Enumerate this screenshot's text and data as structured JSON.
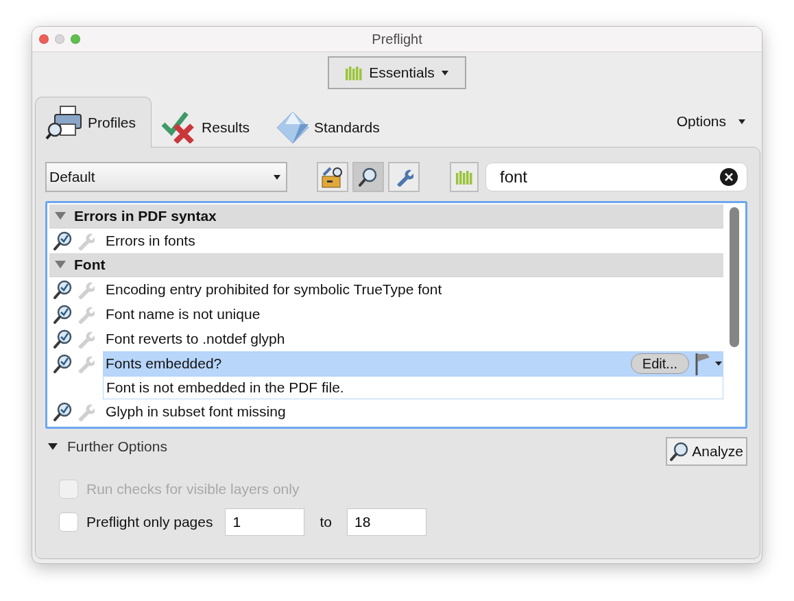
{
  "window": {
    "title": "Preflight"
  },
  "workspace_button": {
    "label": "Essentials"
  },
  "tabs": [
    {
      "label": "Profiles",
      "kind": "profiles",
      "selected": true
    },
    {
      "label": "Results",
      "kind": "results",
      "selected": false
    },
    {
      "label": "Standards",
      "kind": "standards",
      "selected": false
    }
  ],
  "options_menu": {
    "label": "Options"
  },
  "profile_select": {
    "value": "Default"
  },
  "view_buttons": [
    {
      "kind": "fixups",
      "selected": false
    },
    {
      "kind": "checks",
      "selected": true
    },
    {
      "kind": "wrench",
      "selected": false
    }
  ],
  "search": {
    "value": "font"
  },
  "groups": [
    {
      "label": "Errors in PDF syntax",
      "expanded": true,
      "items": [
        {
          "label": "Errors in fonts",
          "selected": false
        }
      ]
    },
    {
      "label": "Font",
      "expanded": true,
      "items": [
        {
          "label": "Encoding entry prohibited for symbolic TrueType font",
          "selected": false
        },
        {
          "label": "Font name is not unique",
          "selected": false
        },
        {
          "label": "Font reverts to .notdef glyph",
          "selected": false
        },
        {
          "label": "Fonts embedded?",
          "selected": true,
          "description": "Font is not embedded in the PDF file.",
          "edit_label": "Edit..."
        },
        {
          "label": "Glyph in subset font missing",
          "selected": false
        }
      ]
    }
  ],
  "further_options": {
    "label": "Further Options",
    "expanded": true
  },
  "analyze_button": {
    "label": "Analyze"
  },
  "options": [
    {
      "kind": "checkbox",
      "label": "Run checks for visible layers only",
      "checked": false,
      "disabled": true
    },
    {
      "kind": "page_range",
      "label": "Preflight only pages",
      "checked": false,
      "disabled": false,
      "from": "1",
      "to_label": "to",
      "to": "18"
    }
  ]
}
